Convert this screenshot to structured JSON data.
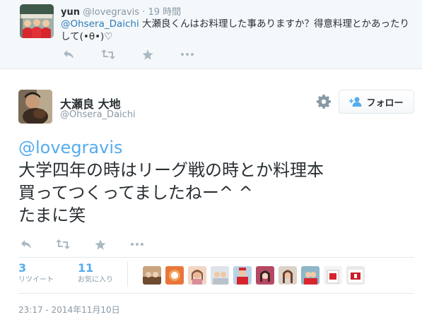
{
  "parent_tweet": {
    "name": "yun",
    "handle": "@lovegravis",
    "dot": "·",
    "time": "19 時間",
    "mention": "@Ohsera_Daichi",
    "text": " 大瀬良くんはお料理した事ありますか？得意料理とかあったりして(•θ•)♡",
    "actions": [
      "reply-icon",
      "retweet-icon",
      "favorite-icon",
      "more-icon"
    ]
  },
  "main_tweet": {
    "name": "大瀬良 大地",
    "handle": "@Ohsera_Daichi",
    "follow_label": "フォロー",
    "mention": "@lovegravis",
    "lines": [
      "大学四年の時はリーグ戦の時とか料理本",
      "買ってつくってましたねー^ ^",
      "たまに笑"
    ],
    "actions": [
      "reply-icon",
      "retweet-icon",
      "favorite-icon",
      "more-icon"
    ],
    "stats": {
      "retweets_count": "3",
      "retweets_label": "リツイート",
      "favorites_count": "11",
      "favorites_label": "お気に入り"
    },
    "timestamp": "23:17 - 2014年11月10日"
  },
  "colors": {
    "link": "#55acee",
    "mention_small": "#2b7bb9",
    "muted": "#8899a6",
    "icon": "#aab8c2",
    "text": "#292f33",
    "border": "#e1e8ed",
    "parent_bg": "#f5f8fa"
  }
}
